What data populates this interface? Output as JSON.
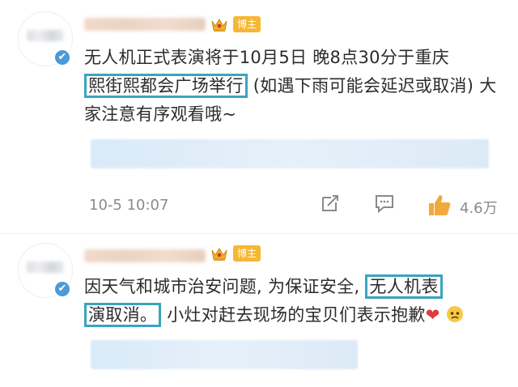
{
  "posts": [
    {
      "badge_label": "博主",
      "text_before": "无人机正式表演将于10月5日 晚8点30分于重庆",
      "highlight": "熙街熙都会广场举行",
      "text_after": "(如遇下雨可能会延迟或取消) 大家注意有序观看哦~",
      "timestamp": "10-5 10:07",
      "likes": "4.6万"
    },
    {
      "badge_label": "博主",
      "text_before": "因天气和城市治安问题, 为保证安全,",
      "highlight_a": "无人机表",
      "highlight_b": "演取消。",
      "text_after": "小灶对赶去现场的宝贝们表示抱歉"
    }
  ],
  "icons": {
    "verified": "✔",
    "repost": "repost-icon",
    "comment": "comment-icon",
    "like": "thumbs-up-icon",
    "heart": "❤"
  },
  "colors": {
    "highlight_border": "#3aa4c0",
    "badge": "#f7b733",
    "verified": "#4b9ad7",
    "like": "#f0a93a"
  }
}
